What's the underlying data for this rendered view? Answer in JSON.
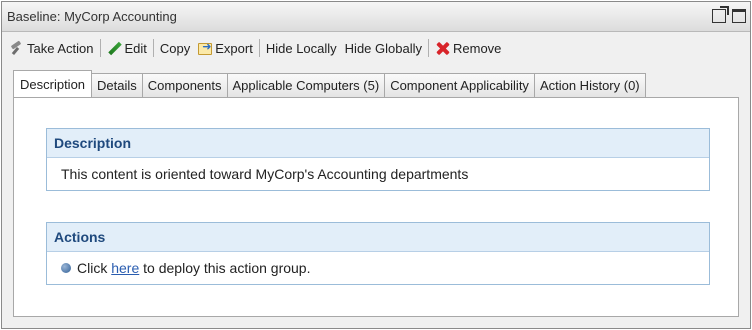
{
  "window": {
    "title": "Baseline: MyCorp Accounting"
  },
  "toolbar": {
    "take_action": "Take Action",
    "edit": "Edit",
    "copy": "Copy",
    "export": "Export",
    "hide_locally": "Hide Locally",
    "hide_globally": "Hide Globally",
    "remove": "Remove"
  },
  "tabs": [
    {
      "label": "Description",
      "active": true
    },
    {
      "label": "Details"
    },
    {
      "label": "Components"
    },
    {
      "label": "Applicable Computers (5)"
    },
    {
      "label": "Component Applicability"
    },
    {
      "label": "Action History (0)"
    }
  ],
  "description_panel": {
    "heading": "Description",
    "text": "This content is oriented toward MyCorp's Accounting departments"
  },
  "actions_panel": {
    "heading": "Actions",
    "prefix": "Click",
    "link": "here",
    "suffix": "to deploy this action group."
  },
  "icons": [
    "popout-icon",
    "maximize-icon",
    "take-action-icon",
    "edit-icon",
    "export-icon",
    "remove-icon",
    "bullet-icon"
  ],
  "colors": {
    "panel_header_bg": "#e2eef9",
    "panel_header_text": "#1f497d",
    "link": "#2a5db0",
    "remove_red": "#d8242a"
  }
}
